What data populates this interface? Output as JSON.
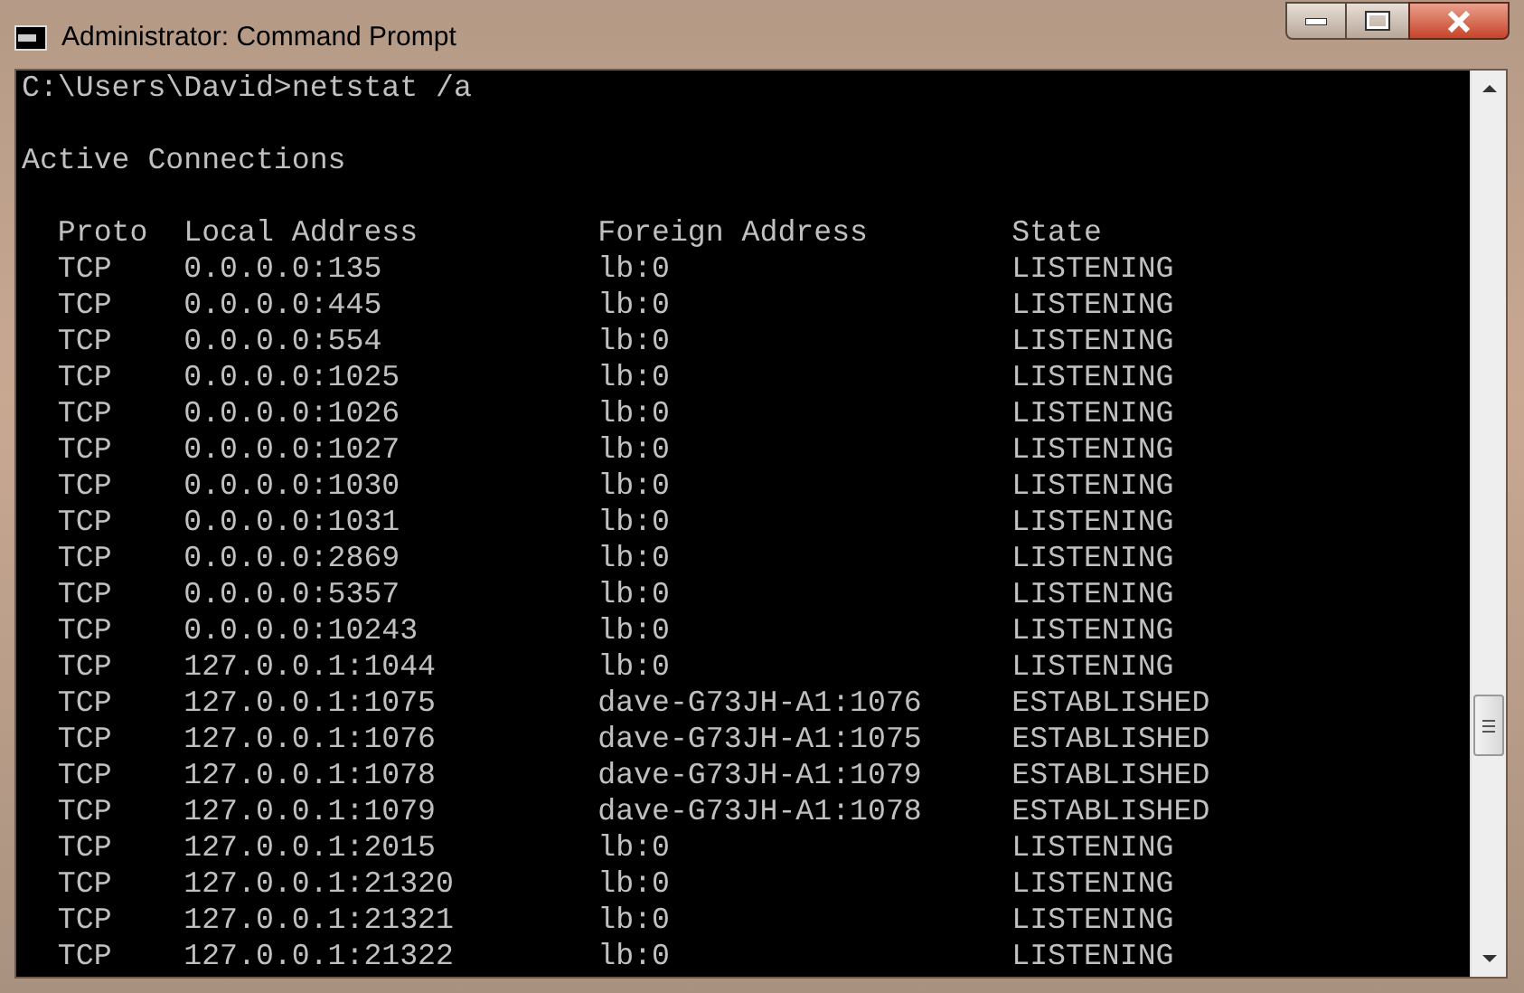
{
  "window": {
    "title": "Administrator: Command Prompt"
  },
  "console": {
    "command_line": "C:\\Users\\David>netstat /a",
    "heading": "Active Connections",
    "columns": [
      "Proto",
      "Local Address",
      "Foreign Address",
      "State"
    ],
    "rows": [
      {
        "proto": "TCP",
        "local": "0.0.0.0:135",
        "foreign": "lb:0",
        "state": "LISTENING"
      },
      {
        "proto": "TCP",
        "local": "0.0.0.0:445",
        "foreign": "lb:0",
        "state": "LISTENING"
      },
      {
        "proto": "TCP",
        "local": "0.0.0.0:554",
        "foreign": "lb:0",
        "state": "LISTENING"
      },
      {
        "proto": "TCP",
        "local": "0.0.0.0:1025",
        "foreign": "lb:0",
        "state": "LISTENING"
      },
      {
        "proto": "TCP",
        "local": "0.0.0.0:1026",
        "foreign": "lb:0",
        "state": "LISTENING"
      },
      {
        "proto": "TCP",
        "local": "0.0.0.0:1027",
        "foreign": "lb:0",
        "state": "LISTENING"
      },
      {
        "proto": "TCP",
        "local": "0.0.0.0:1030",
        "foreign": "lb:0",
        "state": "LISTENING"
      },
      {
        "proto": "TCP",
        "local": "0.0.0.0:1031",
        "foreign": "lb:0",
        "state": "LISTENING"
      },
      {
        "proto": "TCP",
        "local": "0.0.0.0:2869",
        "foreign": "lb:0",
        "state": "LISTENING"
      },
      {
        "proto": "TCP",
        "local": "0.0.0.0:5357",
        "foreign": "lb:0",
        "state": "LISTENING"
      },
      {
        "proto": "TCP",
        "local": "0.0.0.0:10243",
        "foreign": "lb:0",
        "state": "LISTENING"
      },
      {
        "proto": "TCP",
        "local": "127.0.0.1:1044",
        "foreign": "lb:0",
        "state": "LISTENING"
      },
      {
        "proto": "TCP",
        "local": "127.0.0.1:1075",
        "foreign": "dave-G73JH-A1:1076",
        "state": "ESTABLISHED"
      },
      {
        "proto": "TCP",
        "local": "127.0.0.1:1076",
        "foreign": "dave-G73JH-A1:1075",
        "state": "ESTABLISHED"
      },
      {
        "proto": "TCP",
        "local": "127.0.0.1:1078",
        "foreign": "dave-G73JH-A1:1079",
        "state": "ESTABLISHED"
      },
      {
        "proto": "TCP",
        "local": "127.0.0.1:1079",
        "foreign": "dave-G73JH-A1:1078",
        "state": "ESTABLISHED"
      },
      {
        "proto": "TCP",
        "local": "127.0.0.1:2015",
        "foreign": "lb:0",
        "state": "LISTENING"
      },
      {
        "proto": "TCP",
        "local": "127.0.0.1:21320",
        "foreign": "lb:0",
        "state": "LISTENING"
      },
      {
        "proto": "TCP",
        "local": "127.0.0.1:21321",
        "foreign": "lb:0",
        "state": "LISTENING"
      },
      {
        "proto": "TCP",
        "local": "127.0.0.1:21322",
        "foreign": "lb:0",
        "state": "LISTENING"
      }
    ]
  }
}
